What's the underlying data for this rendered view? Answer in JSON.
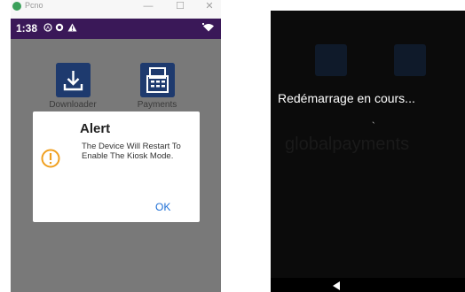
{
  "emulator": {
    "window_title": "Pcno",
    "controls": {
      "minimize": "—",
      "maximize": "☐",
      "close": "✕"
    },
    "status_bar": {
      "time": "1:38",
      "icons": [
        "status-icon-a",
        "status-icon-b",
        "warning-icon",
        "wifi-icon"
      ]
    },
    "tiles": [
      {
        "label": "Downloader",
        "icon": "download-icon"
      },
      {
        "label": "Payments",
        "icon": "payments-icon"
      }
    ],
    "dialog": {
      "title": "Alert",
      "message": "The Device Will Restart To Enable The Kiosk Mode.",
      "ok_label": "OK",
      "icon": "warning-circle-icon"
    },
    "colors": {
      "status_bar": "#3a1858",
      "tile": "#1e3a6e",
      "ok": "#1e6fd6",
      "warn": "#f0a020"
    }
  },
  "restart_screen": {
    "message": "Redémarrage en cours...",
    "tick": "`",
    "background_brand": "globalpayments"
  }
}
